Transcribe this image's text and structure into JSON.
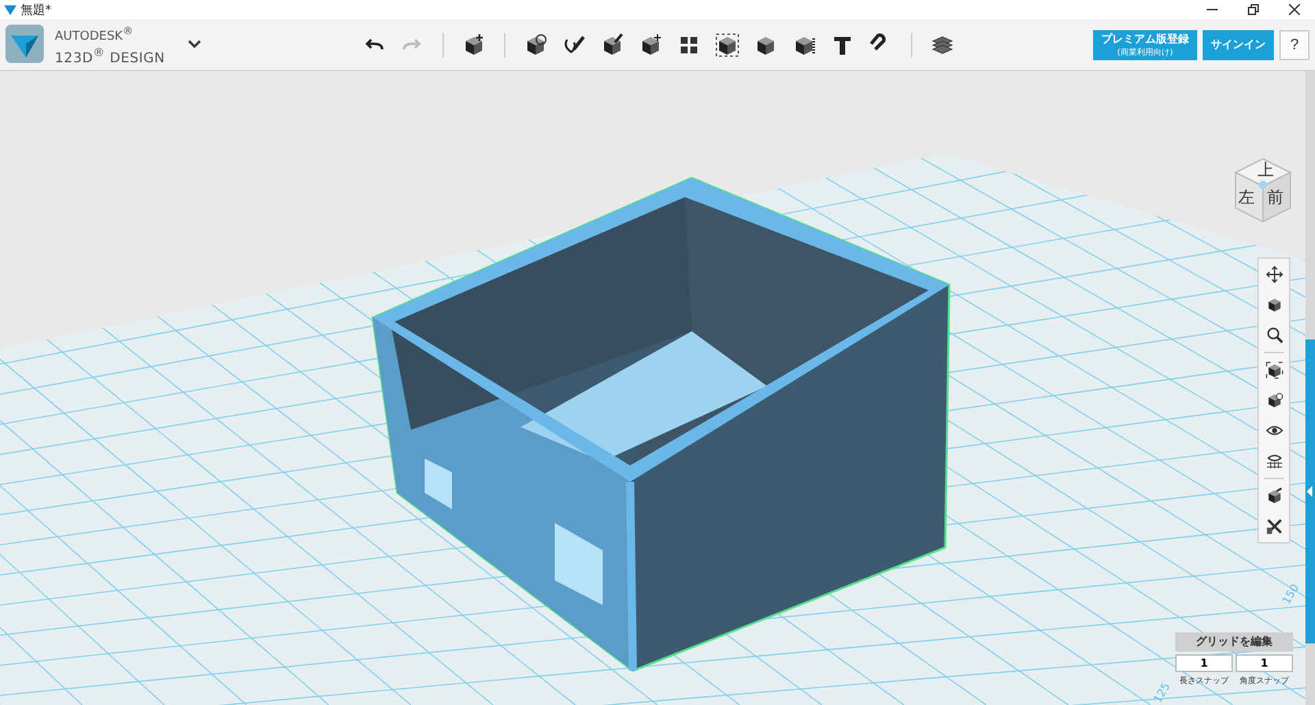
{
  "window": {
    "title": "無題*"
  },
  "app": {
    "logo_line1": "AUTODESK$^{®}$",
    "logo_line2": "123D$^{®}$ DESIGN"
  },
  "account": {
    "premium_label": "プレミアム版登録",
    "premium_sublabel": "(商業利用向け)",
    "signin": "サインイン",
    "help": "?"
  },
  "view_cube": {
    "top": "上",
    "left": "左",
    "front": "前"
  },
  "grid_labels": [
    "150",
    "125"
  ],
  "grid_panel": {
    "title": "グリッドを編集",
    "fields": [
      {
        "label": "長さスナップ",
        "value": "1"
      },
      {
        "label": "角度スナップ",
        "value": "1"
      }
    ]
  }
}
